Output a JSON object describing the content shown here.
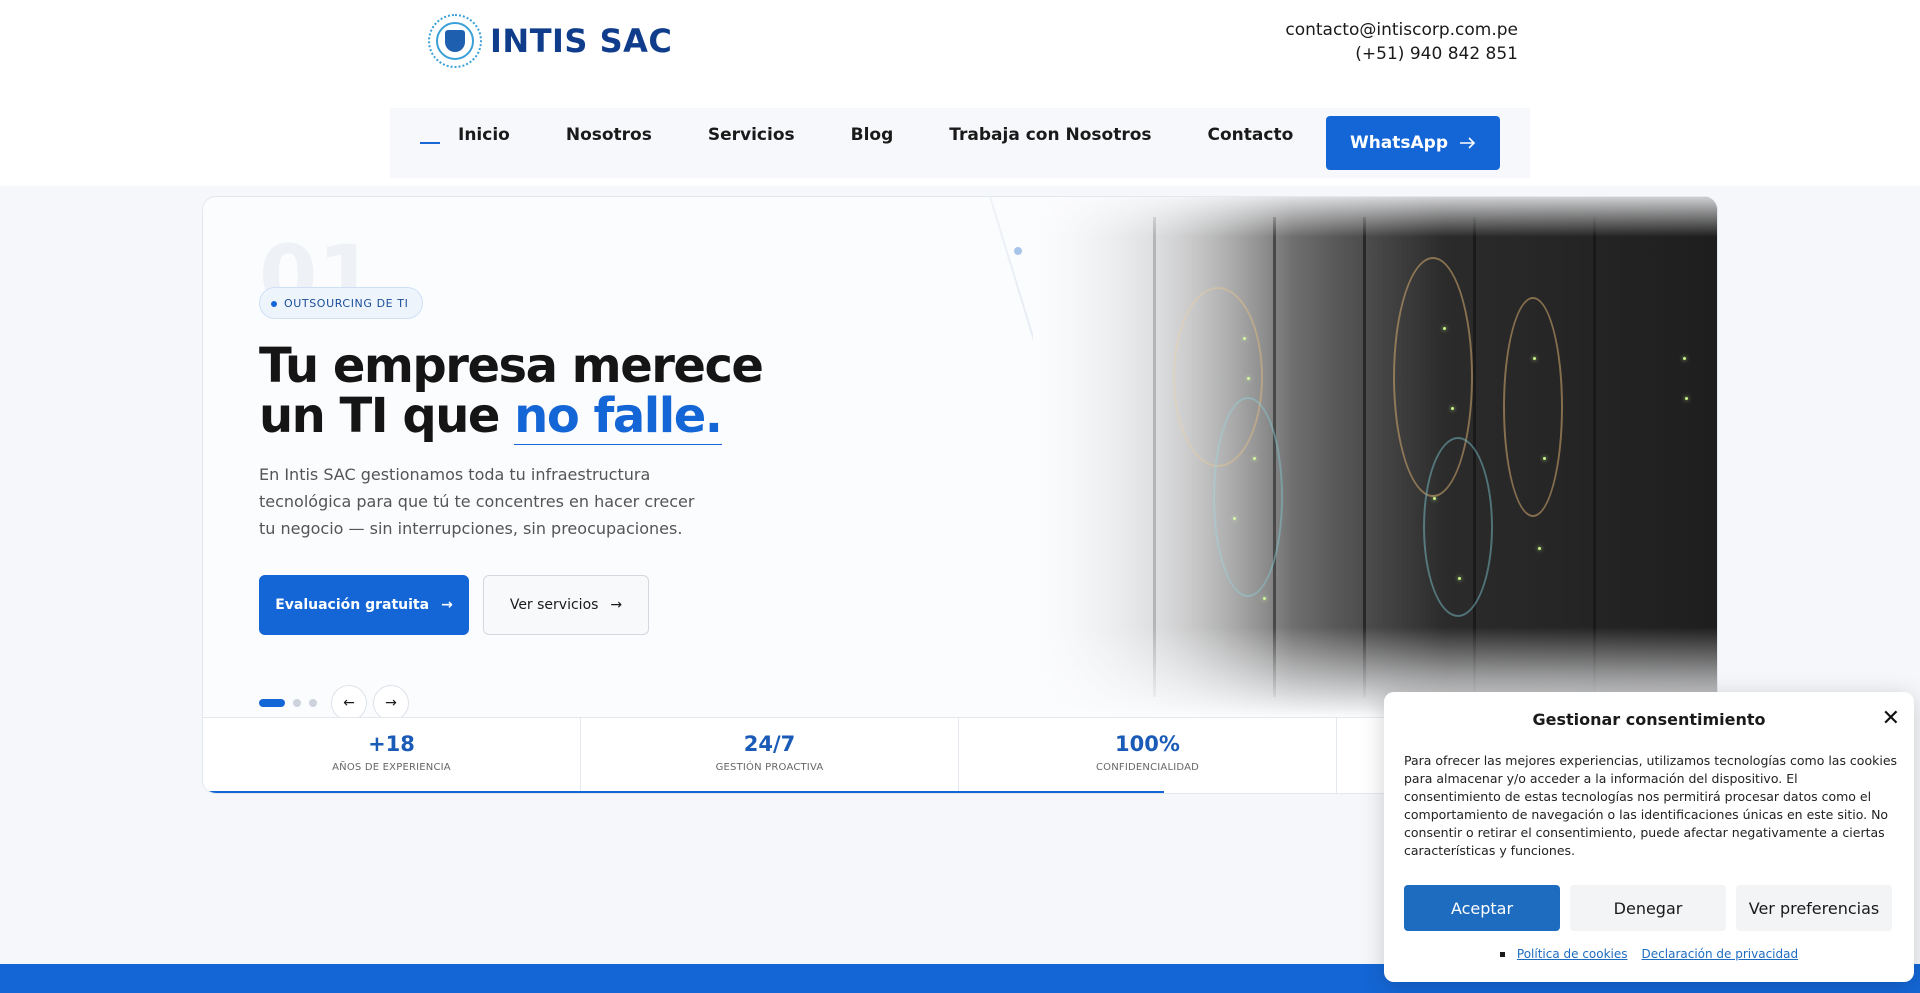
{
  "header": {
    "logo_text": "INTIS SAC",
    "email": "contacto@intiscorp.com.pe",
    "phone": "(+51) 940 842 851"
  },
  "nav": {
    "items": [
      "Inicio",
      "Nosotros",
      "Servicios",
      "Blog",
      "Trabaja con Nosotros",
      "Contacto"
    ],
    "whatsapp_label": "WhatsApp",
    "whatsapp_icon": "arrow-right-icon"
  },
  "hero": {
    "slide_number": "01",
    "badge": "OUTSOURCING DE TI",
    "title_line1": "Tu empresa merece",
    "title_line2_prefix": "un TI que ",
    "title_line2_accent": "no falle.",
    "lead": "En Intis SAC gestionamos toda tu infraestructura tecnológica para que tú te concentres en hacer crecer tu negocio — sin interrupciones, sin preocupaciones.",
    "primary_cta": "Evaluación gratuita",
    "secondary_cta": "Ver servicios",
    "cta_arrow": "→",
    "prev_arrow": "←",
    "next_arrow": "→",
    "slides_total": 3,
    "active_slide": 1,
    "slide_progress": 0.635
  },
  "stats": [
    {
      "value": "+18",
      "label": "AÑOS DE EXPERIENCIA"
    },
    {
      "value": "24/7",
      "label": "GESTIÓN PROACTIVA"
    },
    {
      "value": "100%",
      "label": "CONFIDENCIALIDAD"
    },
    {
      "value": "",
      "label": ""
    }
  ],
  "consent": {
    "title": "Gestionar consentimiento",
    "close_glyph": "✕",
    "body": "Para ofrecer las mejores experiencias, utilizamos tecnologías como las cookies para almacenar y/o acceder a la información del dispositivo. El consentimiento de estas tecnologías nos permitirá procesar datos como el comportamiento de navegación o las identificaciones únicas en este sitio. No consentir o retirar el consentimiento, puede afectar negativamente a ciertas características y funciones.",
    "accept": "Aceptar",
    "deny": "Denegar",
    "preferences": "Ver preferencias",
    "links": [
      "Política de cookies",
      "Declaración de privacidad"
    ]
  },
  "colors": {
    "accent": "#1466d6",
    "brand_dark": "#0f3d8c",
    "consent_accept": "#1e6cc0"
  }
}
